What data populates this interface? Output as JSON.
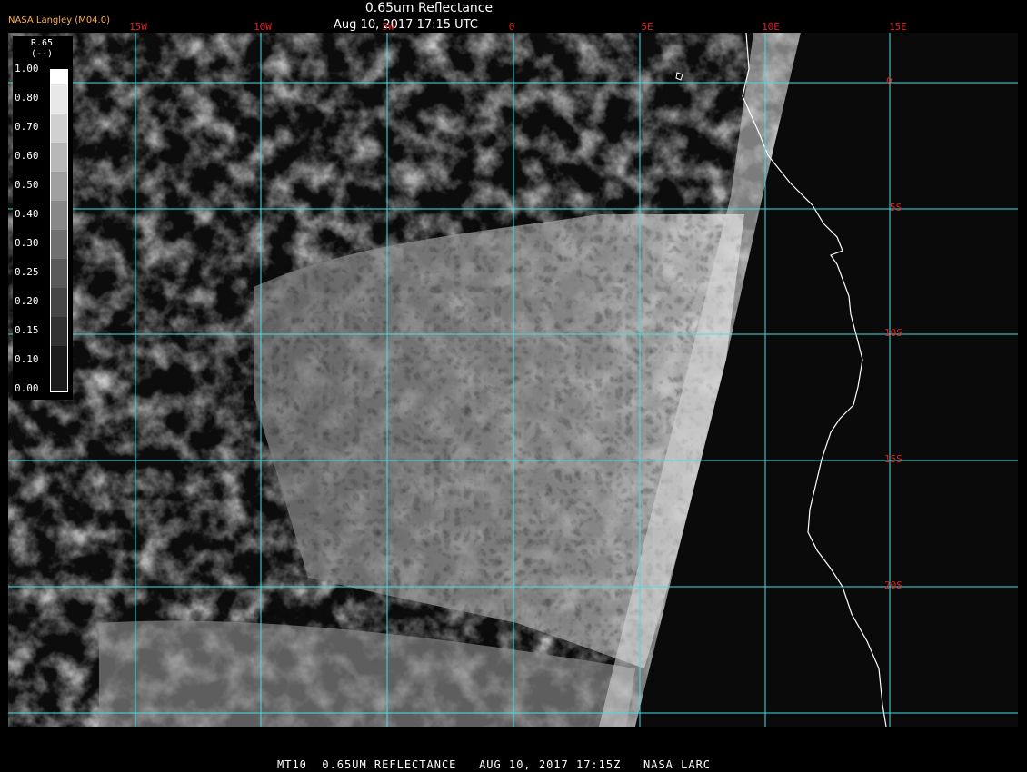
{
  "header": {
    "credit": "NASA Langley (M04.0)",
    "title": "0.65um Reflectance",
    "subtitle": "Aug 10, 2017 17:15 UTC"
  },
  "grid": {
    "longitude_labels": [
      "15W",
      "10W",
      "5W",
      "0",
      "5E",
      "10E",
      "15E"
    ],
    "latitude_labels": [
      "0",
      "5S",
      "10S",
      "15S",
      "20S"
    ]
  },
  "colorbar": {
    "name": "R.65",
    "unit": "(--)",
    "ticks": [
      "1.00",
      "0.80",
      "0.70",
      "0.60",
      "0.50",
      "0.40",
      "0.30",
      "0.25",
      "0.20",
      "0.15",
      "0.10",
      "0.00"
    ]
  },
  "footer": {
    "text": "MT10  0.65UM REFLECTANCE   AUG 10, 2017 17:15Z   NASA LARC"
  },
  "colors": {
    "gridline": "#40e0e0",
    "grid_label": "#e02020",
    "credit": "#ffb050",
    "coastline": "#ffffff",
    "background": "#000000"
  }
}
